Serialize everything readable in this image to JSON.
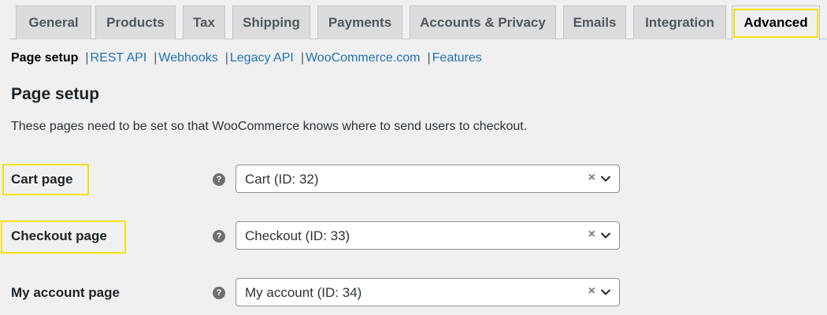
{
  "tabs": [
    {
      "label": "General"
    },
    {
      "label": "Products"
    },
    {
      "label": "Tax"
    },
    {
      "label": "Shipping"
    },
    {
      "label": "Payments"
    },
    {
      "label": "Accounts & Privacy"
    },
    {
      "label": "Emails"
    },
    {
      "label": "Integration"
    },
    {
      "label": "Advanced"
    }
  ],
  "subnav": {
    "current": "Page setup",
    "separator": "|",
    "links": [
      "REST API",
      "Webhooks",
      "Legacy API",
      "WooCommerce.com",
      "Features"
    ]
  },
  "page": {
    "title": "Page setup",
    "description": "These pages need to be set so that WooCommerce knows where to send users to checkout."
  },
  "fields": [
    {
      "label": "Cart page",
      "value": "Cart (ID: 32)"
    },
    {
      "label": "Checkout page",
      "value": "Checkout (ID: 33)"
    },
    {
      "label": "My account page",
      "value": "My account (ID: 34)"
    }
  ],
  "icons": {
    "help": "?",
    "clear": "×"
  },
  "colors": {
    "link": "#2271b1",
    "highlight": "#f5e100",
    "tab_bg": "#dcdcde",
    "page_bg": "#f0f0f1"
  }
}
